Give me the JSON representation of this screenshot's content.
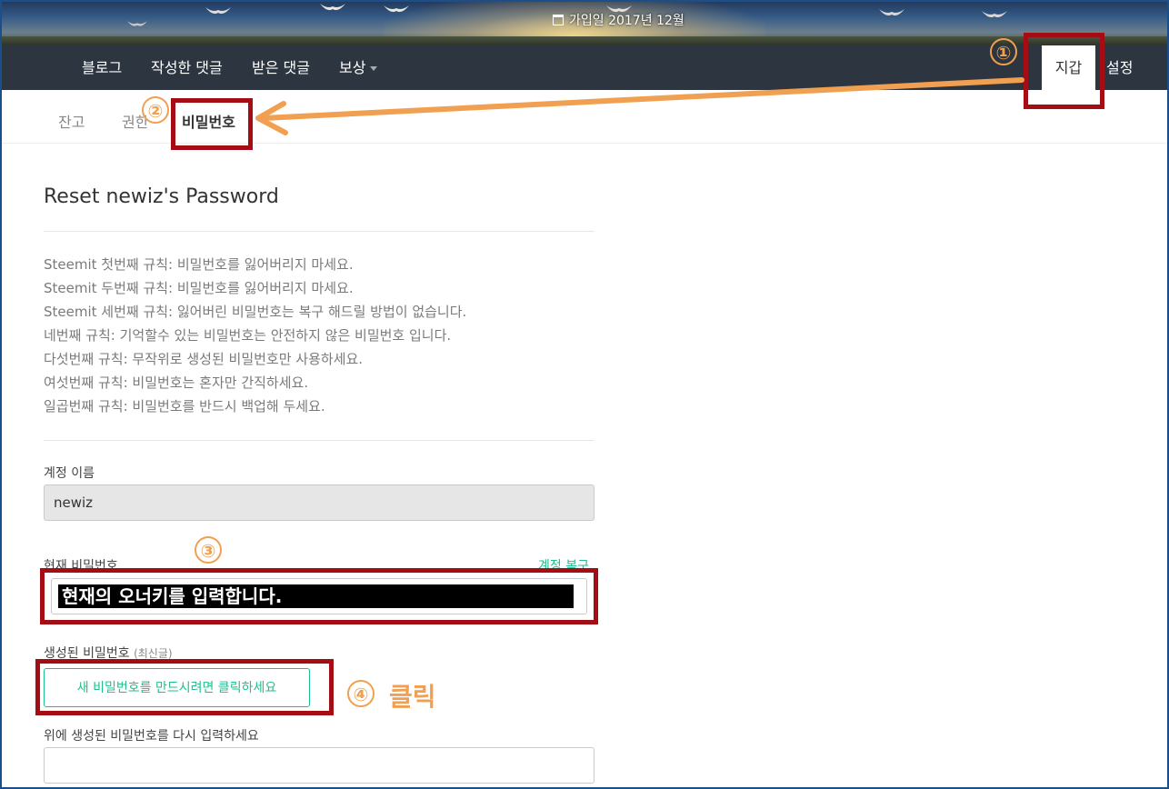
{
  "banner": {
    "joined": "가입일 2017년 12월"
  },
  "nav": {
    "items": [
      {
        "label": "블로그"
      },
      {
        "label": "작성한 댓글"
      },
      {
        "label": "받은 댓글"
      },
      {
        "label": "보상"
      }
    ],
    "wallet": "지갑",
    "settings": "설정"
  },
  "subnav": {
    "items": [
      {
        "label": "잔고"
      },
      {
        "label": "권한"
      },
      {
        "label": "비밀번호"
      }
    ]
  },
  "form": {
    "title": "Reset newiz's Password",
    "rules": [
      "Steemit 첫번째 규칙: 비밀번호를 잃어버리지 마세요.",
      "Steemit 두번째 규칙: 비밀번호를 잃어버리지 마세요.",
      "Steemit 세번째 규칙: 잃어버린 비밀번호는 복구 해드릴 방법이 없습니다.",
      "네번째 규칙: 기억할수 있는 비밀번호는 안전하지 않은 비밀번호 입니다.",
      "다섯번째 규칙: 무작위로 생성된 비밀번호만 사용하세요.",
      "여섯번째 규칙: 비밀번호는 혼자만 간직하세요.",
      "일곱번째 규칙: 비밀번호를 반드시 백업해 두세요."
    ],
    "account_label": "계정 이름",
    "account_value": "newiz",
    "current_pw_label": "현재 비밀번호",
    "recover_link": "계정 복구",
    "generated_label": "생성된 비밀번호",
    "generated_sub": "(최신글)",
    "generate_button": "새 비밀번호를 만드시려면 클릭하세요",
    "reenter_label": "위에 생성된 비밀번호를 다시 입력하세요"
  },
  "annotations": {
    "step1": "①",
    "step2": "②",
    "step3": "③",
    "step4": "④",
    "note": "현재의 오너키를 입력합니다.",
    "click": "클릭",
    "box_color": "#a40d14",
    "arrow_color": "#f0a050"
  }
}
